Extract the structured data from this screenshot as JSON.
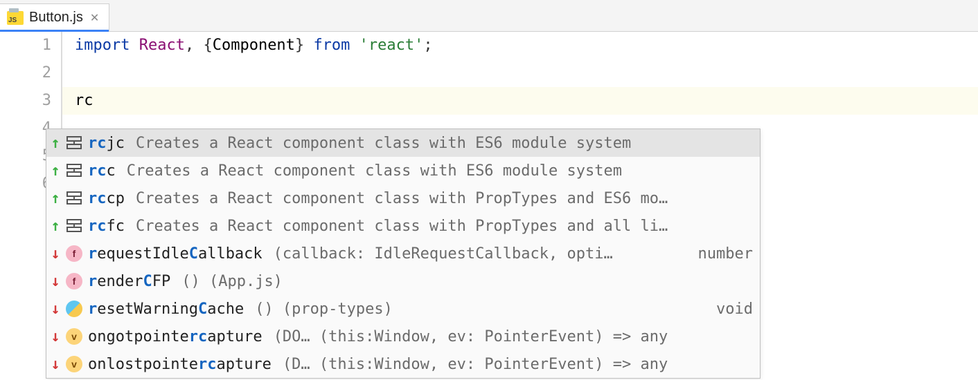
{
  "tab": {
    "filename": "Button.js",
    "icon_text": "JS"
  },
  "gutter": {
    "lines": [
      "1",
      "2",
      "3",
      "4",
      "5",
      "6"
    ]
  },
  "code": {
    "line1": {
      "kw1": "import",
      "cls": "React",
      "comma": ",",
      "brace_open": "{",
      "component": "Component",
      "brace_close": "}",
      "kw2": "from",
      "str": "'react'",
      "semi": ";"
    },
    "line3_prefix": "rc"
  },
  "autocomplete": {
    "rows": [
      {
        "dir": "up",
        "kind": "template",
        "key_hl": "rc",
        "key_rest": "jc",
        "desc": "Creates a React component class with ES6 module system",
        "tail": "",
        "selected": true
      },
      {
        "dir": "up",
        "kind": "template",
        "key_hl": "rc",
        "key_rest": "c",
        "desc": "Creates a React component class with ES6 module system",
        "tail": ""
      },
      {
        "dir": "up",
        "kind": "template",
        "key_hl": "rc",
        "key_rest": "cp",
        "desc": "Creates a React component class with PropTypes and ES6 mo…",
        "tail": ""
      },
      {
        "dir": "up",
        "kind": "template",
        "key_hl": "rc",
        "key_rest": "fc",
        "desc": "Creates a React component class with PropTypes and all li…",
        "tail": ""
      },
      {
        "dir": "down",
        "kind": "f",
        "key_parts": [
          [
            "r",
            "hl"
          ],
          [
            "equestIdle",
            ""
          ],
          [
            "C",
            "hl"
          ],
          [
            "allback",
            ""
          ]
        ],
        "desc": "(callback: IdleRequestCallback, opti…",
        "tail": "number"
      },
      {
        "dir": "down",
        "kind": "f",
        "key_parts": [
          [
            "r",
            "hl"
          ],
          [
            "ender",
            ""
          ],
          [
            "C",
            "hl"
          ],
          [
            "FP",
            ""
          ]
        ],
        "desc": "() (App.js)",
        "tail": ""
      },
      {
        "dir": "down",
        "kind": "circle",
        "key_parts": [
          [
            "r",
            "hl"
          ],
          [
            "esetWarning",
            ""
          ],
          [
            "C",
            "hl"
          ],
          [
            "ache",
            ""
          ]
        ],
        "desc": "() (prop-types)",
        "tail": "void"
      },
      {
        "dir": "down",
        "kind": "v",
        "key_parts": [
          [
            "ongotpointe",
            ""
          ],
          [
            "rc",
            "hl"
          ],
          [
            "apture",
            ""
          ]
        ],
        "desc": "(DO… (this:Window, ev: PointerEvent) => any",
        "tail": ""
      },
      {
        "dir": "down",
        "kind": "v",
        "key_parts": [
          [
            "onlostpointe",
            ""
          ],
          [
            "rc",
            "hl"
          ],
          [
            "apture",
            ""
          ]
        ],
        "desc": "(D… (this:Window, ev: PointerEvent) => any",
        "tail": ""
      }
    ]
  }
}
